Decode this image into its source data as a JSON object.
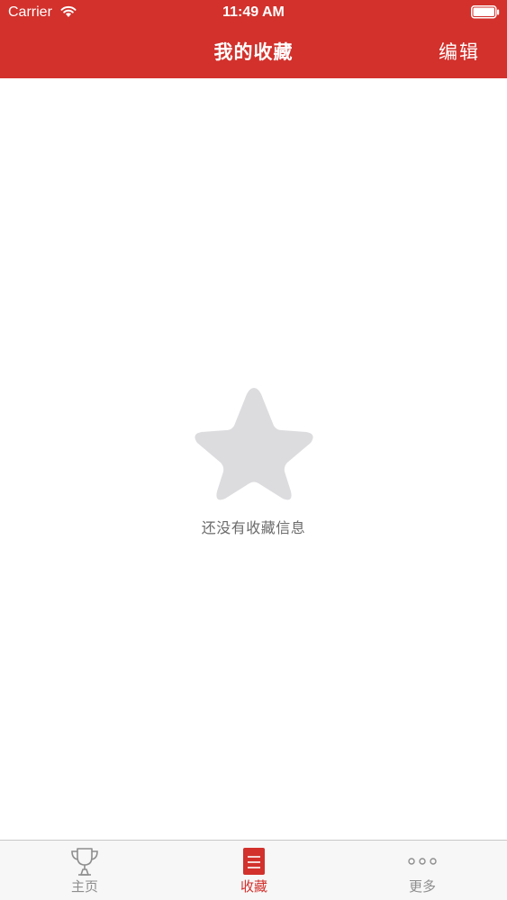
{
  "status_bar": {
    "carrier": "Carrier",
    "time": "11:49 AM",
    "wifi_icon": "wifi-icon",
    "battery_icon": "battery-full-icon"
  },
  "nav": {
    "title": "我的收藏",
    "edit_label": "编辑",
    "bar_color": "#d2312c"
  },
  "empty_state": {
    "icon": "star-icon",
    "message": "还没有收藏信息"
  },
  "tab_bar": {
    "active_color": "#d2312c",
    "inactive_color": "#8e8e8e",
    "tabs": [
      {
        "label": "主页",
        "icon": "trophy-icon",
        "active": false
      },
      {
        "label": "收藏",
        "icon": "document-icon",
        "active": true
      },
      {
        "label": "更多",
        "icon": "more-dots-icon",
        "active": false
      }
    ]
  }
}
